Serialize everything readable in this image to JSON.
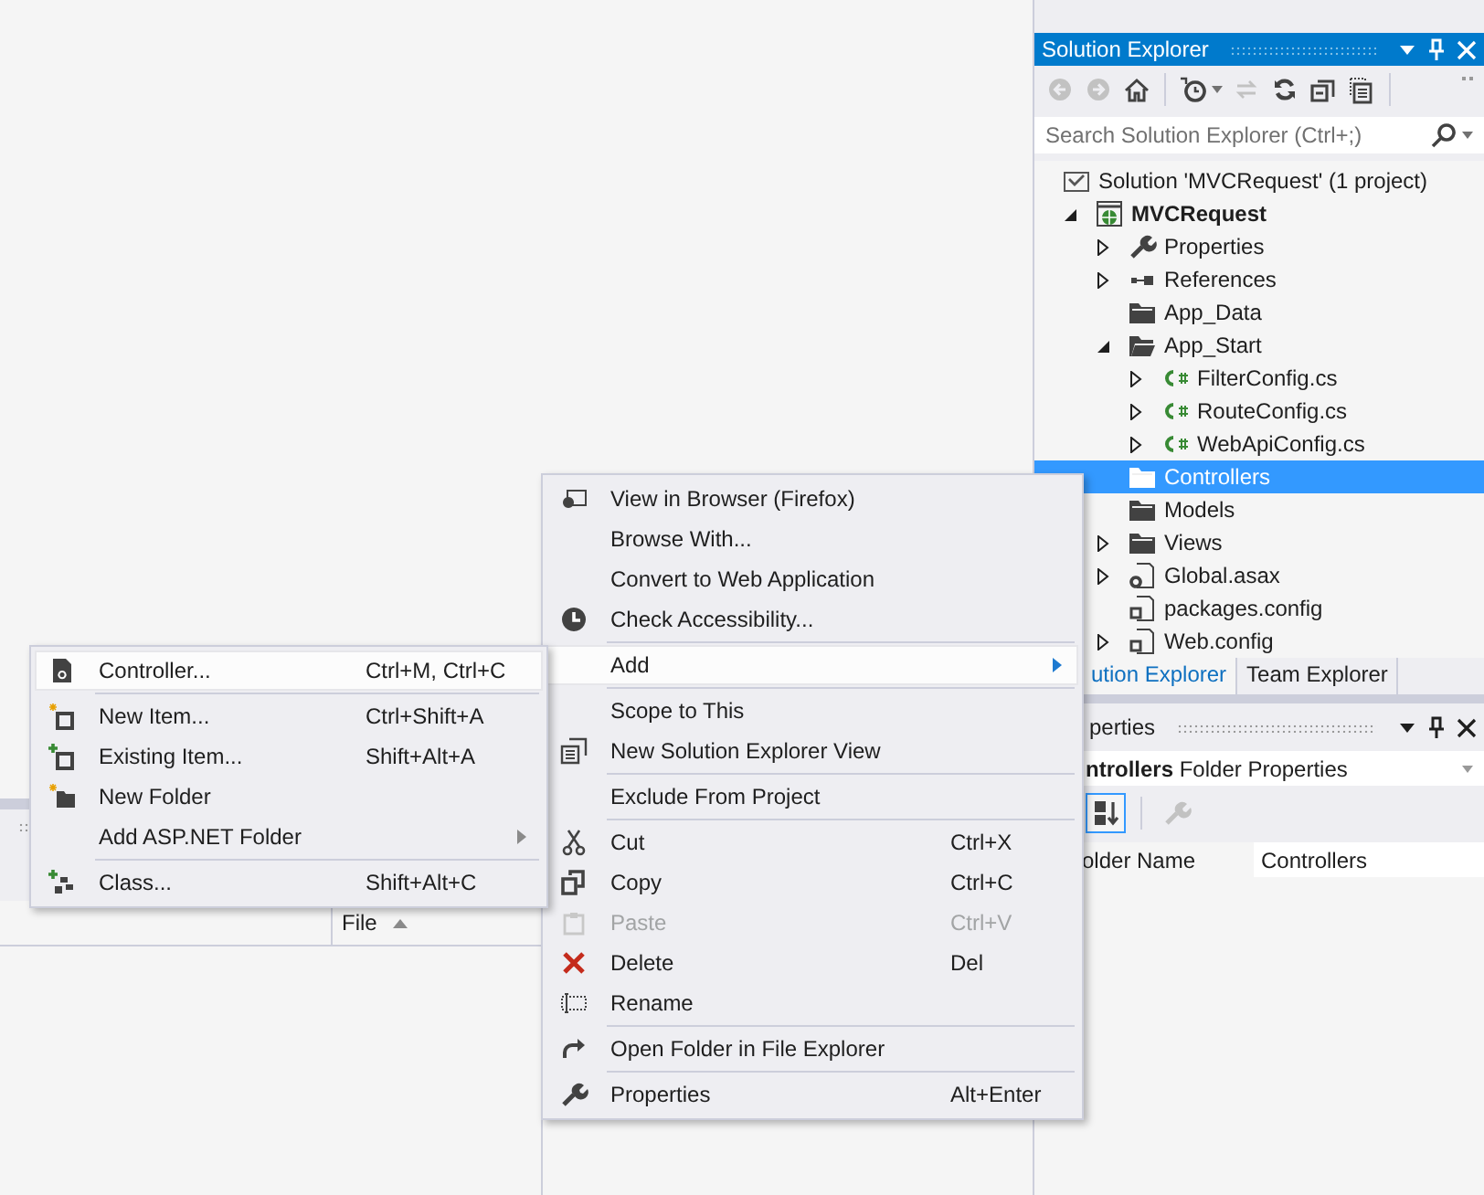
{
  "output_pane": {
    "column_header": {
      "label": "File"
    }
  },
  "solution_explorer": {
    "title": "Solution Explorer",
    "toolbar": [
      {
        "kind": "back",
        "disabled": true
      },
      {
        "kind": "forward",
        "disabled": true
      },
      {
        "kind": "home",
        "disabled": false
      },
      {
        "kind": "history",
        "disabled": false
      },
      {
        "kind": "sync",
        "disabled": true
      },
      {
        "kind": "refresh",
        "disabled": false
      },
      {
        "kind": "collapse",
        "disabled": false
      },
      {
        "kind": "show_all",
        "disabled": false
      }
    ],
    "search": {
      "placeholder": "Search Solution Explorer (Ctrl+;)"
    },
    "tree": [
      {
        "label": "Solution 'MVCRequest' (1 project)",
        "kind": "solution",
        "selected": false,
        "children": [
          {
            "label": "MVCRequest",
            "kind": "project",
            "expanded": true,
            "selected": false,
            "children": [
              {
                "label": "Properties",
                "kind": "properties",
                "expanded": false,
                "selected": false
              },
              {
                "label": "References",
                "kind": "references",
                "expanded": false,
                "selected": false
              },
              {
                "label": "App_Data",
                "kind": "folder",
                "selected": false
              },
              {
                "label": "App_Start",
                "kind": "folder",
                "expanded": true,
                "selected": false,
                "children": [
                  {
                    "label": "FilterConfig.cs",
                    "kind": "csharp",
                    "expanded": false,
                    "selected": false
                  },
                  {
                    "label": "RouteConfig.cs",
                    "kind": "csharp",
                    "expanded": false,
                    "selected": false
                  },
                  {
                    "label": "WebApiConfig.cs",
                    "kind": "csharp",
                    "expanded": false,
                    "selected": false
                  }
                ]
              },
              {
                "label": "Controllers",
                "kind": "folder",
                "selected": true
              },
              {
                "label": "Models",
                "kind": "folder",
                "selected": false
              },
              {
                "label": "Views",
                "kind": "folder",
                "expanded": false,
                "selected": false
              },
              {
                "label": "Global.asax",
                "kind": "asax",
                "expanded": false,
                "selected": false
              },
              {
                "label": "packages.config",
                "kind": "config",
                "selected": false
              },
              {
                "label": "Web.config",
                "kind": "config",
                "expanded": false,
                "selected": false
              }
            ]
          }
        ]
      }
    ]
  },
  "tabs": [
    {
      "label": "ution Explorer",
      "selected": true
    },
    {
      "label": "Team Explorer",
      "selected": false
    }
  ],
  "properties": {
    "title": "perties",
    "object_name": "ntrollers",
    "object_type": "Folder Properties",
    "toolbar": [
      {
        "kind": "sort_alpha",
        "selected": true,
        "disabled": false
      },
      {
        "kind": "property_pages",
        "selected": false,
        "disabled": true
      }
    ],
    "rows": [
      {
        "name": "older Name",
        "value": "Controllers"
      }
    ]
  },
  "context_menu": {
    "items": [
      {
        "kind": "item",
        "label": "View in Browser (Firefox)",
        "highlighted": false,
        "disabled": false
      },
      {
        "kind": "item",
        "label": "Browse With...",
        "highlighted": false,
        "disabled": false
      },
      {
        "kind": "item",
        "label": "Convert to Web Application",
        "highlighted": false,
        "disabled": false
      },
      {
        "kind": "item",
        "label": "Check Accessibility...",
        "highlighted": false,
        "disabled": false
      },
      {
        "kind": "separator"
      },
      {
        "kind": "item",
        "label": "Add",
        "submenu": true,
        "highlighted": true,
        "disabled": false
      },
      {
        "kind": "separator"
      },
      {
        "kind": "item",
        "label": "Scope to This",
        "highlighted": false,
        "disabled": false
      },
      {
        "kind": "item",
        "label": "New Solution Explorer View",
        "highlighted": false,
        "disabled": false
      },
      {
        "kind": "separator"
      },
      {
        "kind": "item",
        "label": "Exclude From Project",
        "highlighted": false,
        "disabled": false
      },
      {
        "kind": "separator"
      },
      {
        "kind": "item",
        "label": "Cut",
        "shortcut": "Ctrl+X",
        "highlighted": false,
        "disabled": false
      },
      {
        "kind": "item",
        "label": "Copy",
        "shortcut": "Ctrl+C",
        "highlighted": false,
        "disabled": false
      },
      {
        "kind": "item",
        "label": "Paste",
        "shortcut": "Ctrl+V",
        "highlighted": false,
        "disabled": true
      },
      {
        "kind": "item",
        "label": "Delete",
        "shortcut": "Del",
        "highlighted": false,
        "disabled": false
      },
      {
        "kind": "item",
        "label": "Rename",
        "highlighted": false,
        "disabled": false
      },
      {
        "kind": "separator"
      },
      {
        "kind": "item",
        "label": "Open Folder in File Explorer",
        "highlighted": false,
        "disabled": false
      },
      {
        "kind": "separator"
      },
      {
        "kind": "item",
        "label": "Properties",
        "shortcut": "Alt+Enter",
        "highlighted": false,
        "disabled": false
      }
    ]
  },
  "submenu": {
    "items": [
      {
        "kind": "item",
        "label": "Controller...",
        "shortcut": "Ctrl+M, Ctrl+C",
        "highlighted": true,
        "disabled": false
      },
      {
        "kind": "separator"
      },
      {
        "kind": "item",
        "label": "New Item...",
        "shortcut": "Ctrl+Shift+A",
        "highlighted": false,
        "disabled": false
      },
      {
        "kind": "item",
        "label": "Existing Item...",
        "shortcut": "Shift+Alt+A",
        "highlighted": false,
        "disabled": false
      },
      {
        "kind": "item",
        "label": "New Folder",
        "highlighted": false,
        "disabled": false
      },
      {
        "kind": "item",
        "label": "Add ASP.NET Folder",
        "submenu": true,
        "highlighted": false,
        "disabled": false
      },
      {
        "kind": "separator"
      },
      {
        "kind": "item",
        "label": "Class...",
        "shortcut": "Shift+Alt+C",
        "highlighted": false,
        "disabled": false
      }
    ]
  }
}
